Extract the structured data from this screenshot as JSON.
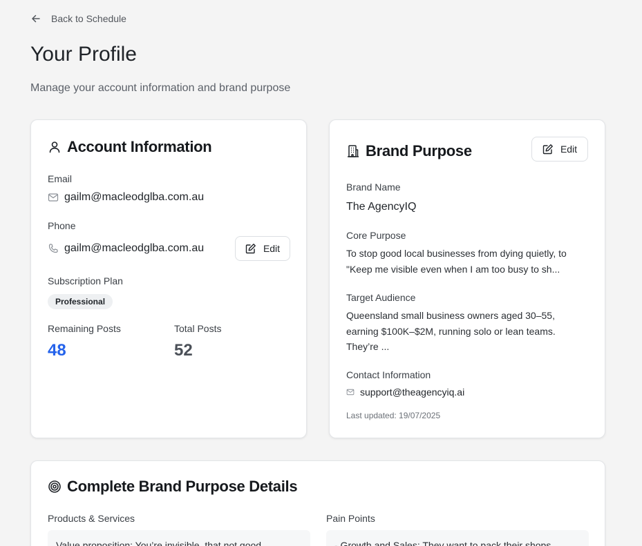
{
  "nav": {
    "back_label": "Back to Schedule"
  },
  "header": {
    "title": "Your Profile",
    "subtitle": "Manage your account information and brand purpose"
  },
  "account": {
    "title": "Account Information",
    "email_label": "Email",
    "email_value": "gailm@macleodglba.com.au",
    "phone_label": "Phone",
    "phone_value": "gailm@macleodglba.com.au",
    "edit_label": "Edit",
    "plan_label": "Subscription Plan",
    "plan_value": "Professional",
    "remaining_label": "Remaining Posts",
    "remaining_value": "48",
    "total_label": "Total Posts",
    "total_value": "52"
  },
  "brand": {
    "title": "Brand Purpose",
    "edit_label": "Edit",
    "name_label": "Brand Name",
    "name_value": "The AgencyIQ",
    "core_label": "Core Purpose",
    "core_value": "To stop good local businesses from dying quietly, to \"Keep me visible even when I am too busy to sh...",
    "audience_label": "Target Audience",
    "audience_value": "Queensland small business owners aged 30–55, earning $100K–$2M, running solo or lean teams. They’re ...",
    "contact_label": "Contact Information",
    "contact_value": "support@theagencyiq.ai",
    "updated": "Last updated: 19/07/2025"
  },
  "details": {
    "title": "Complete Brand Purpose Details",
    "products_label": "Products & Services",
    "products_value": "Value proposition: You’re invisible, that not good",
    "pain_label": "Pain Points",
    "pain_value": "- Growth and Sales: They want to pack their shops"
  },
  "colors": {
    "accent_blue": "#2563eb",
    "stat_gray": "#4b5058"
  },
  "icons": {
    "back": "arrow-left-icon",
    "account": "user-icon",
    "brand": "building-icon",
    "details": "target-icon",
    "email": "mail-icon",
    "phone": "phone-icon",
    "edit": "pencil-square-icon"
  }
}
